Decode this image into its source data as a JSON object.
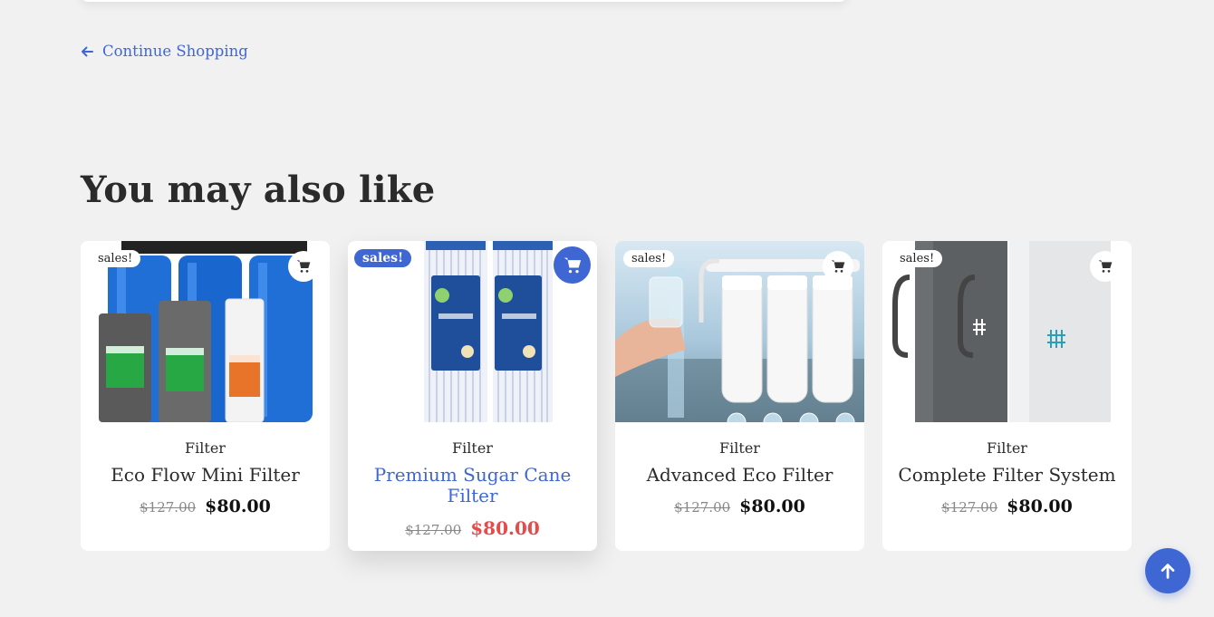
{
  "navigation": {
    "continue_label": "Continue Shopping",
    "continue_icon": "arrow-left-icon"
  },
  "related": {
    "title": "You may also like",
    "products": [
      {
        "badge": "sales!",
        "category": "Filter",
        "name": "Eco Flow Mini Filter",
        "old_price": "$127.00",
        "price": "$80.00",
        "image": "whole-house-filter-system-image"
      },
      {
        "badge": "sales!",
        "category": "Filter",
        "name": "Premium Sugar Cane Filter",
        "old_price": "$127.00",
        "price": "$80.00",
        "image": "pleated-filter-cartridges-image"
      },
      {
        "badge": "sales!",
        "category": "Filter",
        "name": "Advanced Eco Filter",
        "old_price": "$127.00",
        "price": "$80.00",
        "image": "under-sink-filter-system-image"
      },
      {
        "badge": "sales!",
        "category": "Filter",
        "name": "Complete Filter System",
        "old_price": "$127.00",
        "price": "$80.00",
        "image": "lifestraw-bottles-image"
      }
    ]
  },
  "colors": {
    "accent": "#3f67d4",
    "sale_price_hover": "#e84a4a",
    "background": "#f1f1f1"
  },
  "back_to_top_icon": "arrow-up-icon"
}
